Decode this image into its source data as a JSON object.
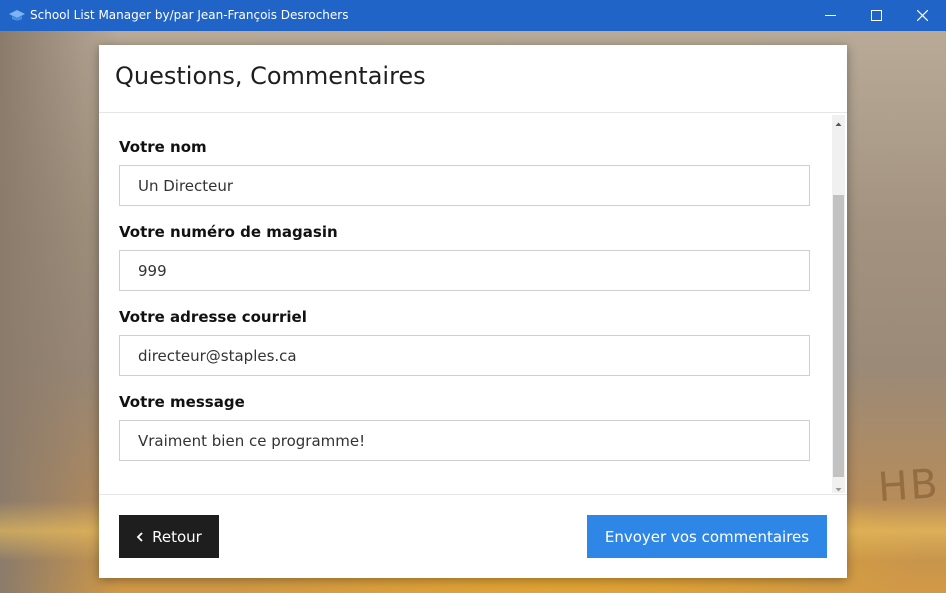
{
  "window": {
    "title": "School List Manager by/par Jean-François Desrochers",
    "icon": "graduation-cap-icon",
    "accent": "#1f64c6"
  },
  "card": {
    "title": "Questions, Commentaires"
  },
  "form": {
    "fields": [
      {
        "label": "Votre nom",
        "value": "Un Directeur"
      },
      {
        "label": "Votre numéro de magasin",
        "value": "999"
      },
      {
        "label": "Votre adresse courriel",
        "value": "directeur@staples.ca"
      },
      {
        "label": "Votre message",
        "value": "Vraiment bien ce programme!"
      }
    ]
  },
  "footer": {
    "back_label": "Retour",
    "back_icon": "chevron-left-icon",
    "send_label": "Envoyer vos commentaires",
    "back_color": "#1e1e1e",
    "send_color": "#2e87e6"
  },
  "background": {
    "pencil_text": "HB"
  }
}
